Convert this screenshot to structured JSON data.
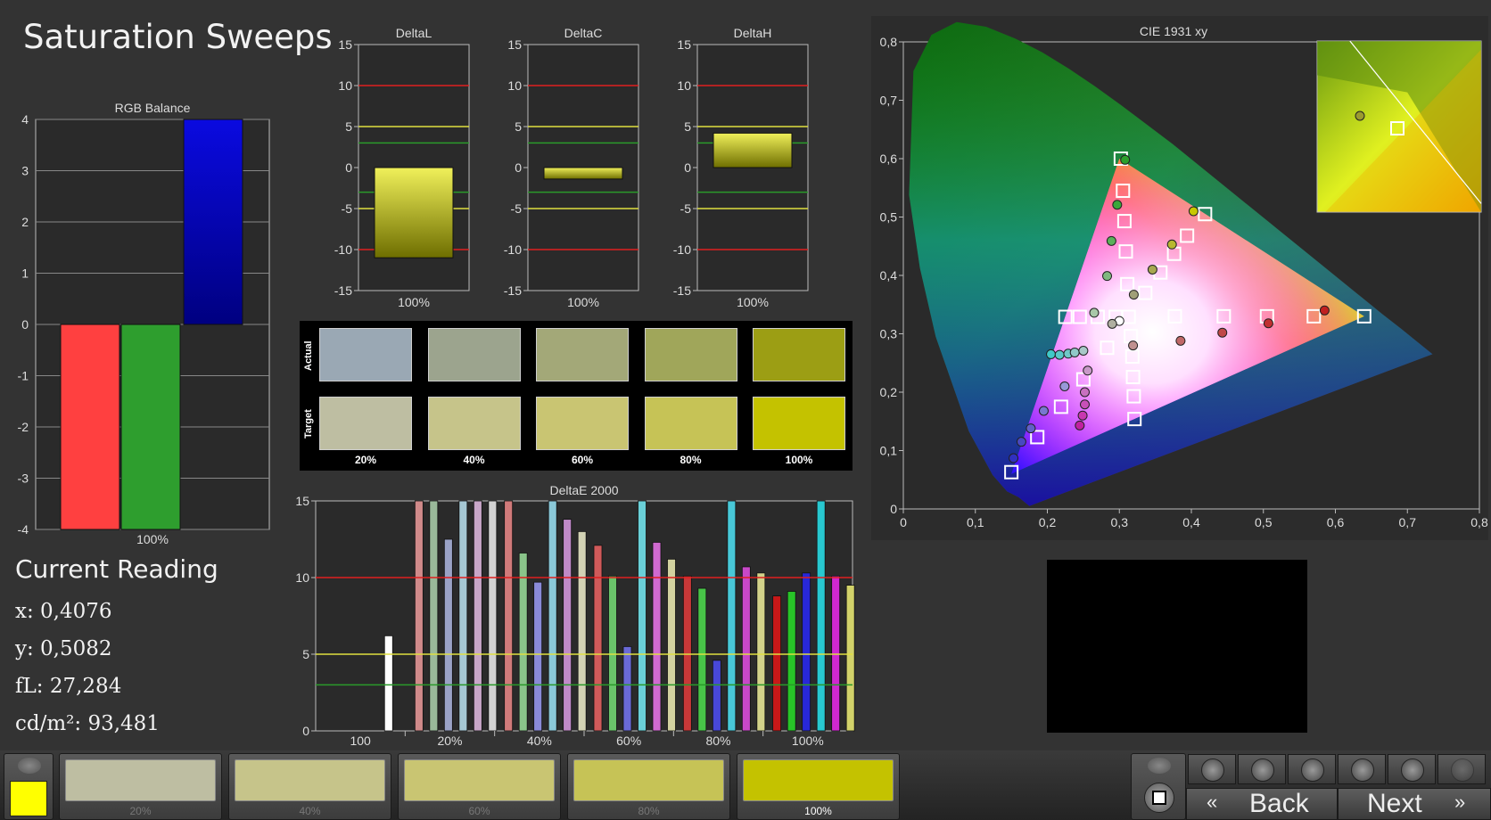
{
  "title": "Saturation Sweeps",
  "current_reading": {
    "title": "Current Reading",
    "x": "x: 0,4076",
    "y": "y: 0,5082",
    "fl": "fL: 27,284",
    "cdm2": "cd/m²: 93,481"
  },
  "rgb_balance": {
    "type": "bar",
    "title": "RGB Balance",
    "categories": [
      "100%"
    ],
    "series": [
      {
        "name": "R",
        "values": [
          -4.0
        ],
        "color": "#ff4040"
      },
      {
        "name": "G",
        "values": [
          -4.0
        ],
        "color": "#2e9e2e"
      },
      {
        "name": "B",
        "values": [
          4.0
        ],
        "color": "#0a0ad0"
      }
    ],
    "ylim": [
      -4,
      4
    ],
    "yticks": [
      "4",
      "3",
      "2",
      "1",
      "0",
      "-1",
      "-2",
      "-3",
      "-4"
    ],
    "xlabel": "100%"
  },
  "delta_charts": [
    {
      "type": "bar",
      "title": "DeltaL",
      "category": "100%",
      "value": -11,
      "ylim": [
        -15,
        15
      ],
      "yticks": [
        "15",
        "10",
        "5",
        "0",
        "-5",
        "-10",
        "-15"
      ]
    },
    {
      "type": "bar",
      "title": "DeltaC",
      "category": "100%",
      "value": -1.4,
      "ylim": [
        -15,
        15
      ],
      "yticks": [
        "15",
        "10",
        "5",
        "0",
        "-5",
        "-10",
        "-15"
      ]
    },
    {
      "type": "bar",
      "title": "DeltaH",
      "category": "100%",
      "value": 4.2,
      "ylim": [
        -15,
        15
      ],
      "yticks": [
        "15",
        "10",
        "5",
        "0",
        "-5",
        "-10",
        "-15"
      ]
    }
  ],
  "swatches": {
    "row_labels": [
      "Actual",
      "Target"
    ],
    "labels": [
      "20%",
      "40%",
      "60%",
      "80%",
      "100%"
    ],
    "actual": [
      "#9aa8b4",
      "#9ca48e",
      "#a3a878",
      "#a0a65a",
      "#9c9e14"
    ],
    "target": [
      "#bebea2",
      "#c6c48a",
      "#c9c572",
      "#c6c356",
      "#c4c200"
    ]
  },
  "deltae_chart": {
    "type": "bar",
    "title": "DeltaE 2000",
    "categories": [
      "100",
      "20%",
      "40%",
      "60%",
      "80%",
      "100%"
    ],
    "ylim": [
      0,
      15
    ],
    "yticks": [
      "15",
      "10",
      "5",
      "0"
    ],
    "groups": [
      {
        "values": [
          6.2
        ],
        "colors": [
          "#ffffff"
        ]
      },
      {
        "values": [
          15,
          15,
          12.5,
          15,
          15,
          15
        ],
        "colors": [
          "#d08a8a",
          "#9ab99a",
          "#9aa2c6",
          "#a6c8d4",
          "#c8a6c8",
          "#d2d2d2"
        ]
      },
      {
        "values": [
          15,
          11.6,
          9.7,
          15,
          13.8,
          13
        ],
        "colors": [
          "#d07a7a",
          "#8ac48a",
          "#8a8ad8",
          "#8ac8d8",
          "#c08ac8",
          "#d2d2b4"
        ]
      },
      {
        "values": [
          12.1,
          10.1,
          5.5,
          15,
          12.3,
          11.2
        ],
        "colors": [
          "#d05a5a",
          "#6ac46a",
          "#6a6ad8",
          "#6ad0d8",
          "#d06ad0",
          "#d2d2a0"
        ]
      },
      {
        "values": [
          10.1,
          9.3,
          4.6,
          15,
          10.7,
          10.3
        ],
        "colors": [
          "#c83838",
          "#48c448",
          "#4848d8",
          "#48c8d8",
          "#c848c8",
          "#d2d28a"
        ]
      },
      {
        "values": [
          8.8,
          9.1,
          10.3,
          15,
          10.1,
          9.5
        ],
        "colors": [
          "#c81818",
          "#28c428",
          "#2828d8",
          "#28c8d0",
          "#d028d0",
          "#d2d26a"
        ]
      }
    ],
    "lines": [
      10,
      5,
      3
    ]
  },
  "cie_chart": {
    "type": "scatter",
    "title": "CIE 1931 xy",
    "xlim": [
      0,
      0.8
    ],
    "ylim": [
      0,
      0.8
    ],
    "xticks": [
      "0",
      "0,1",
      "0,2",
      "0,3",
      "0,4",
      "0,5",
      "0,6",
      "0,7",
      "0,8"
    ],
    "yticks": [
      "0",
      "0,1",
      "0,2",
      "0,3",
      "0,4",
      "0,5",
      "0,6",
      "0,7",
      "0,8"
    ],
    "targets": [
      [
        0.313,
        0.329
      ],
      [
        0.302,
        0.6
      ],
      [
        0.305,
        0.545
      ],
      [
        0.307,
        0.493
      ],
      [
        0.309,
        0.441
      ],
      [
        0.311,
        0.385
      ],
      [
        0.64,
        0.33
      ],
      [
        0.57,
        0.33
      ],
      [
        0.505,
        0.33
      ],
      [
        0.445,
        0.33
      ],
      [
        0.377,
        0.33
      ],
      [
        0.15,
        0.063
      ],
      [
        0.186,
        0.123
      ],
      [
        0.219,
        0.175
      ],
      [
        0.25,
        0.222
      ],
      [
        0.283,
        0.276
      ],
      [
        0.225,
        0.329
      ],
      [
        0.245,
        0.329
      ],
      [
        0.27,
        0.329
      ],
      [
        0.295,
        0.329
      ],
      [
        0.321,
        0.154
      ],
      [
        0.32,
        0.193
      ],
      [
        0.319,
        0.226
      ],
      [
        0.318,
        0.261
      ],
      [
        0.316,
        0.296
      ],
      [
        0.419,
        0.505
      ],
      [
        0.394,
        0.468
      ],
      [
        0.376,
        0.437
      ],
      [
        0.357,
        0.405
      ],
      [
        0.336,
        0.37
      ]
    ],
    "actuals": [
      {
        "x": 0.3,
        "y": 0.322,
        "c": "#ffffff"
      },
      {
        "x": 0.308,
        "y": 0.598,
        "c": "#2ca02c"
      },
      {
        "x": 0.297,
        "y": 0.521,
        "c": "#3aa83a"
      },
      {
        "x": 0.289,
        "y": 0.459,
        "c": "#5ab05a"
      },
      {
        "x": 0.283,
        "y": 0.399,
        "c": "#80b880"
      },
      {
        "x": 0.265,
        "y": 0.336,
        "c": "#a8c8a8"
      },
      {
        "x": 0.585,
        "y": 0.34,
        "c": "#c02020"
      },
      {
        "x": 0.507,
        "y": 0.318,
        "c": "#c03030"
      },
      {
        "x": 0.443,
        "y": 0.302,
        "c": "#c04848"
      },
      {
        "x": 0.385,
        "y": 0.288,
        "c": "#c06868"
      },
      {
        "x": 0.319,
        "y": 0.28,
        "c": "#c09090"
      },
      {
        "x": 0.153,
        "y": 0.087,
        "c": "#3030c0"
      },
      {
        "x": 0.164,
        "y": 0.115,
        "c": "#4848c0"
      },
      {
        "x": 0.177,
        "y": 0.138,
        "c": "#6060c8"
      },
      {
        "x": 0.195,
        "y": 0.168,
        "c": "#7878d0"
      },
      {
        "x": 0.224,
        "y": 0.21,
        "c": "#9898d8"
      },
      {
        "x": 0.205,
        "y": 0.265,
        "c": "#40c8c8"
      },
      {
        "x": 0.217,
        "y": 0.264,
        "c": "#58c8c8"
      },
      {
        "x": 0.229,
        "y": 0.266,
        "c": "#70c8c8"
      },
      {
        "x": 0.238,
        "y": 0.268,
        "c": "#90c8c8"
      },
      {
        "x": 0.25,
        "y": 0.271,
        "c": "#a8c8c8"
      },
      {
        "x": 0.245,
        "y": 0.143,
        "c": "#c020a0"
      },
      {
        "x": 0.249,
        "y": 0.16,
        "c": "#c838b0"
      },
      {
        "x": 0.252,
        "y": 0.179,
        "c": "#c850b8"
      },
      {
        "x": 0.252,
        "y": 0.2,
        "c": "#c870c0"
      },
      {
        "x": 0.256,
        "y": 0.237,
        "c": "#c898c8"
      },
      {
        "x": 0.403,
        "y": 0.51,
        "c": "#c8c800"
      },
      {
        "x": 0.373,
        "y": 0.453,
        "c": "#b8b830"
      },
      {
        "x": 0.346,
        "y": 0.41,
        "c": "#a8a850"
      },
      {
        "x": 0.32,
        "y": 0.367,
        "c": "#a0a078"
      },
      {
        "x": 0.29,
        "y": 0.317,
        "c": "#b0b0a0"
      }
    ]
  },
  "bottom_tiles": [
    {
      "label": "20%",
      "color": "#bebea2"
    },
    {
      "label": "40%",
      "color": "#c6c48a"
    },
    {
      "label": "60%",
      "color": "#c9c572"
    },
    {
      "label": "80%",
      "color": "#c6c356"
    },
    {
      "label": "100%",
      "color": "#c4c200"
    }
  ],
  "current_color": "#ffff00",
  "nav": {
    "back": "Back",
    "next": "Next"
  },
  "controls": [
    "stop-icon",
    "play-icon",
    "range-icon",
    "loop-icon",
    "refresh-icon",
    "disabled-icon"
  ]
}
